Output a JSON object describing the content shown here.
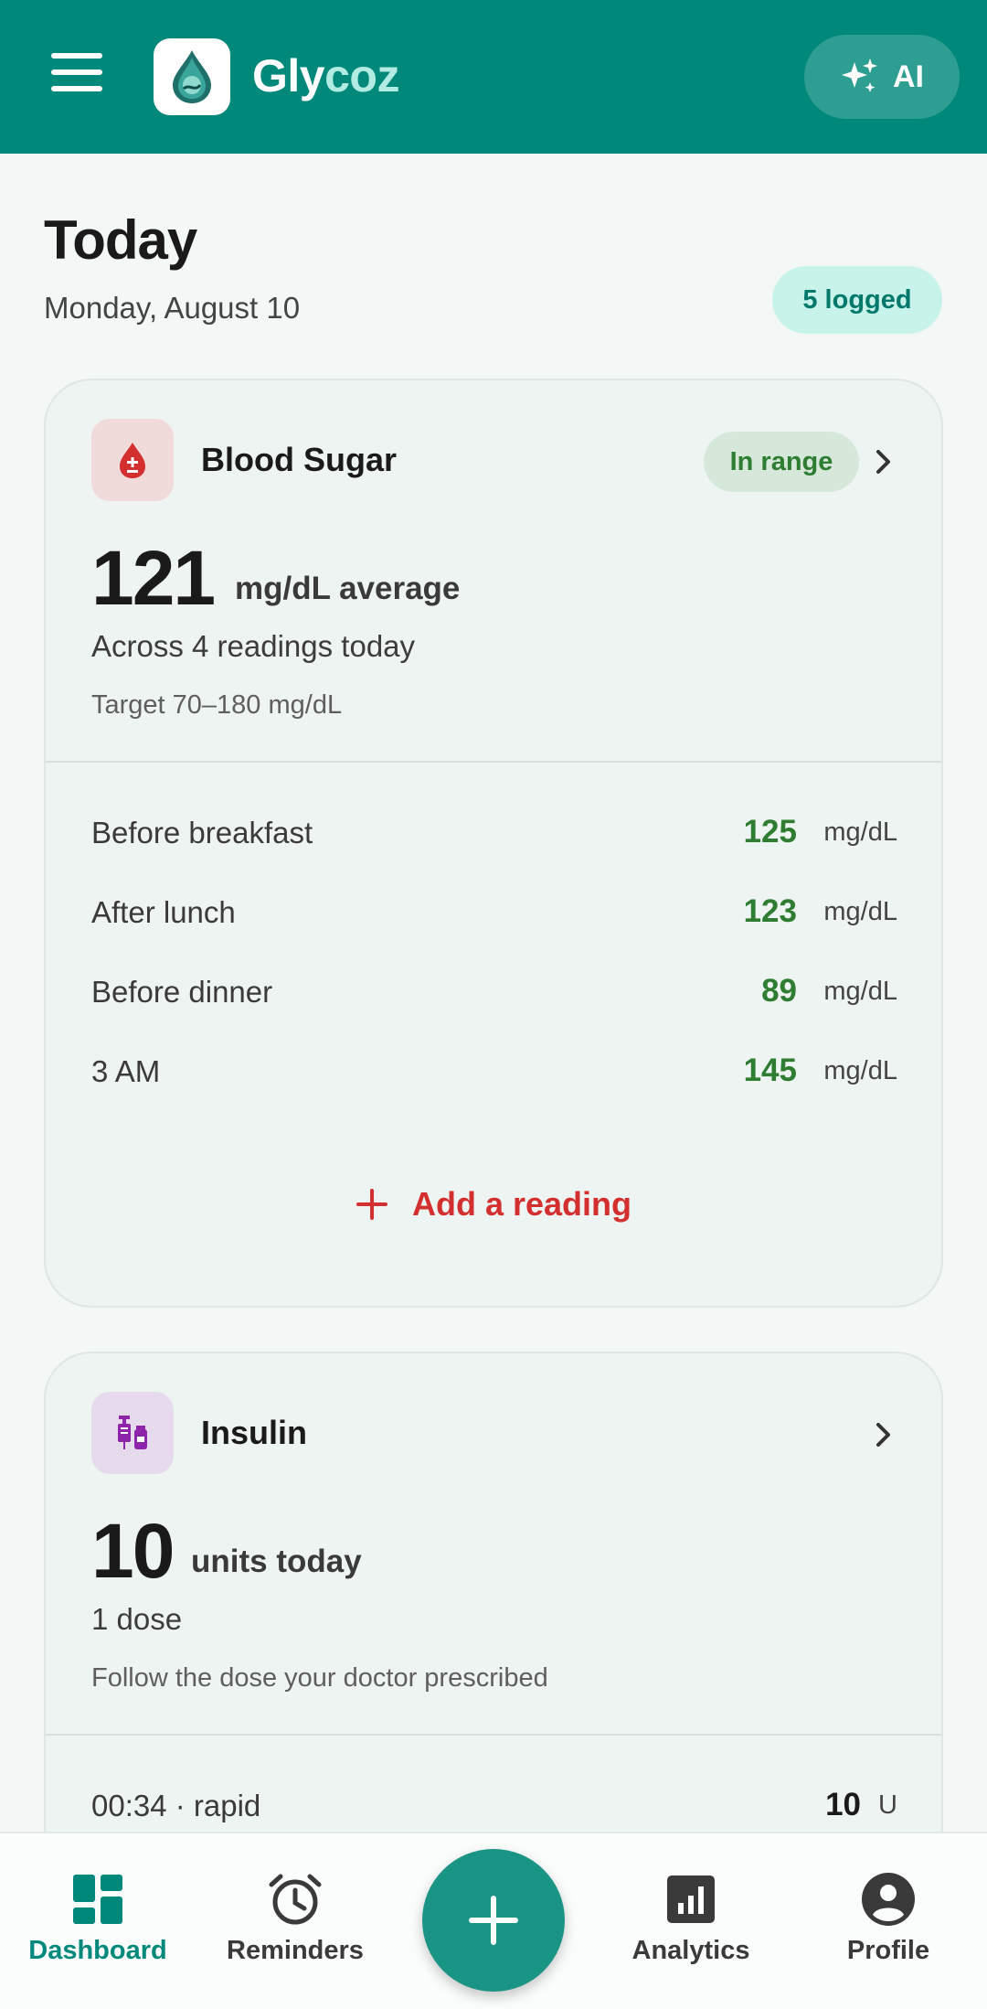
{
  "app": {
    "brand_part1": "Gly",
    "brand_part2": "coz",
    "ai_label": "AI"
  },
  "header": {
    "title": "Today",
    "date": "Monday, August 10",
    "logged_badge": "5 logged"
  },
  "blood_sugar": {
    "title": "Blood Sugar",
    "status": "In range",
    "average": "121",
    "average_unit": "mg/dL average",
    "summary": "Across 4 readings today",
    "target": "Target 70–180 mg/dL",
    "readings": [
      {
        "label": "Before breakfast",
        "value": "125",
        "unit": "mg/dL"
      },
      {
        "label": "After lunch",
        "value": "123",
        "unit": "mg/dL"
      },
      {
        "label": "Before dinner",
        "value": "89",
        "unit": "mg/dL"
      },
      {
        "label": "3 AM",
        "value": "145",
        "unit": "mg/dL"
      }
    ],
    "add_label": "Add a reading"
  },
  "insulin": {
    "title": "Insulin",
    "total": "10",
    "total_unit": "units today",
    "doses": "1 dose",
    "note": "Follow the dose your doctor prescribed",
    "entries": [
      {
        "label": "00:34 · rapid",
        "value": "10",
        "unit": "U"
      }
    ]
  },
  "nav": {
    "dashboard": "Dashboard",
    "reminders": "Reminders",
    "analytics": "Analytics",
    "profile": "Profile"
  },
  "colors": {
    "primary": "#00897b",
    "in_range": "#2e7d32",
    "accent_red": "#d32f2f",
    "insulin_purple": "#8e24aa"
  }
}
